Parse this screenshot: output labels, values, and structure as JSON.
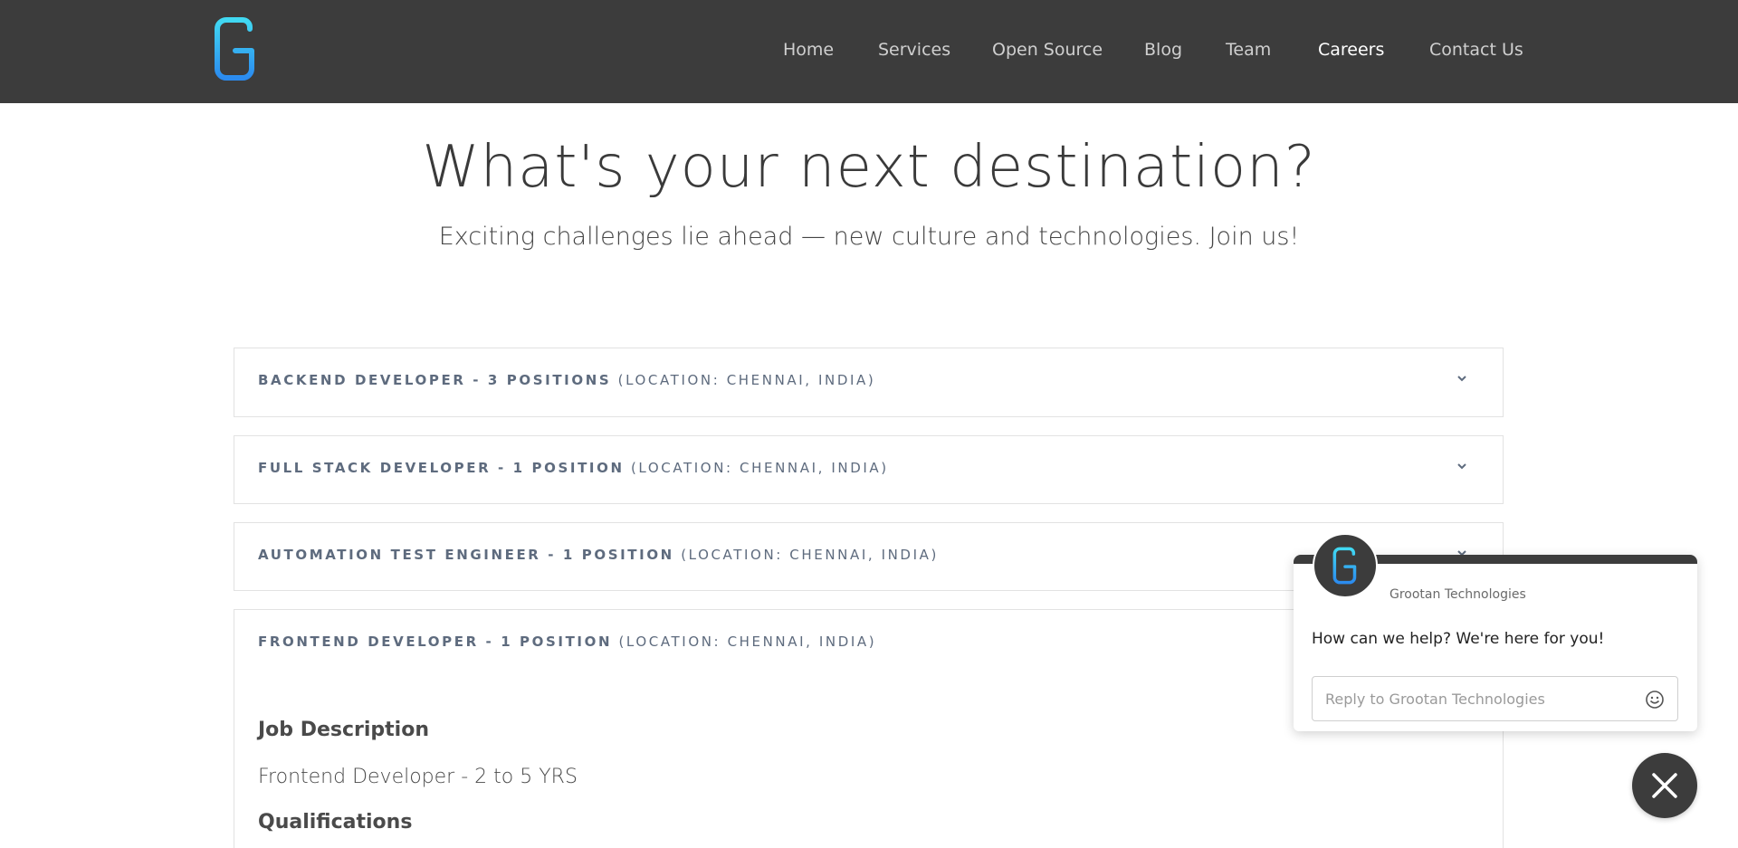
{
  "header": {
    "logo_icon": "grootan-g-logo",
    "nav": [
      {
        "label": "Home"
      },
      {
        "label": "Services"
      },
      {
        "label": "Open Source"
      },
      {
        "label": "Blog"
      },
      {
        "label": "Team"
      },
      {
        "label": "Careers",
        "active": true
      },
      {
        "label": "Contact Us"
      }
    ]
  },
  "hero": {
    "title": "What's your next destination?",
    "subtitle": "Exciting challenges lie ahead — new culture and technologies. Join us!"
  },
  "jobs": [
    {
      "title": "BACKEND DEVELOPER - 3 POSITIONS",
      "location": "(LOCATION: CHENNAI, INDIA)"
    },
    {
      "title": "FULL STACK DEVELOPER - 1 POSITION",
      "location": "(LOCATION: CHENNAI, INDIA)"
    },
    {
      "title": "AUTOMATION TEST ENGINEER - 1 POSITION",
      "location": "(LOCATION: CHENNAI, INDIA)"
    },
    {
      "title": "FRONTEND DEVELOPER - 1 POSITION",
      "location": "(LOCATION: CHENNAI, INDIA)"
    }
  ],
  "expanded_job": {
    "heading_description": "Job Description",
    "description": "Frontend Developer - 2 to 5 YRS",
    "heading_qualifications": "Qualifications"
  },
  "chat": {
    "company": "Grootan Technologies",
    "message": "How can we help? We're here for you!",
    "placeholder": "Reply to Grootan Technologies",
    "emoji_icon": "smiley-icon",
    "close_icon": "close-icon"
  },
  "colors": {
    "header_bg": "#3c3c3c",
    "logo_gradient_start": "#3fd3f0",
    "logo_gradient_end": "#2c8ef0",
    "job_title_color": "#5e6b7e"
  }
}
